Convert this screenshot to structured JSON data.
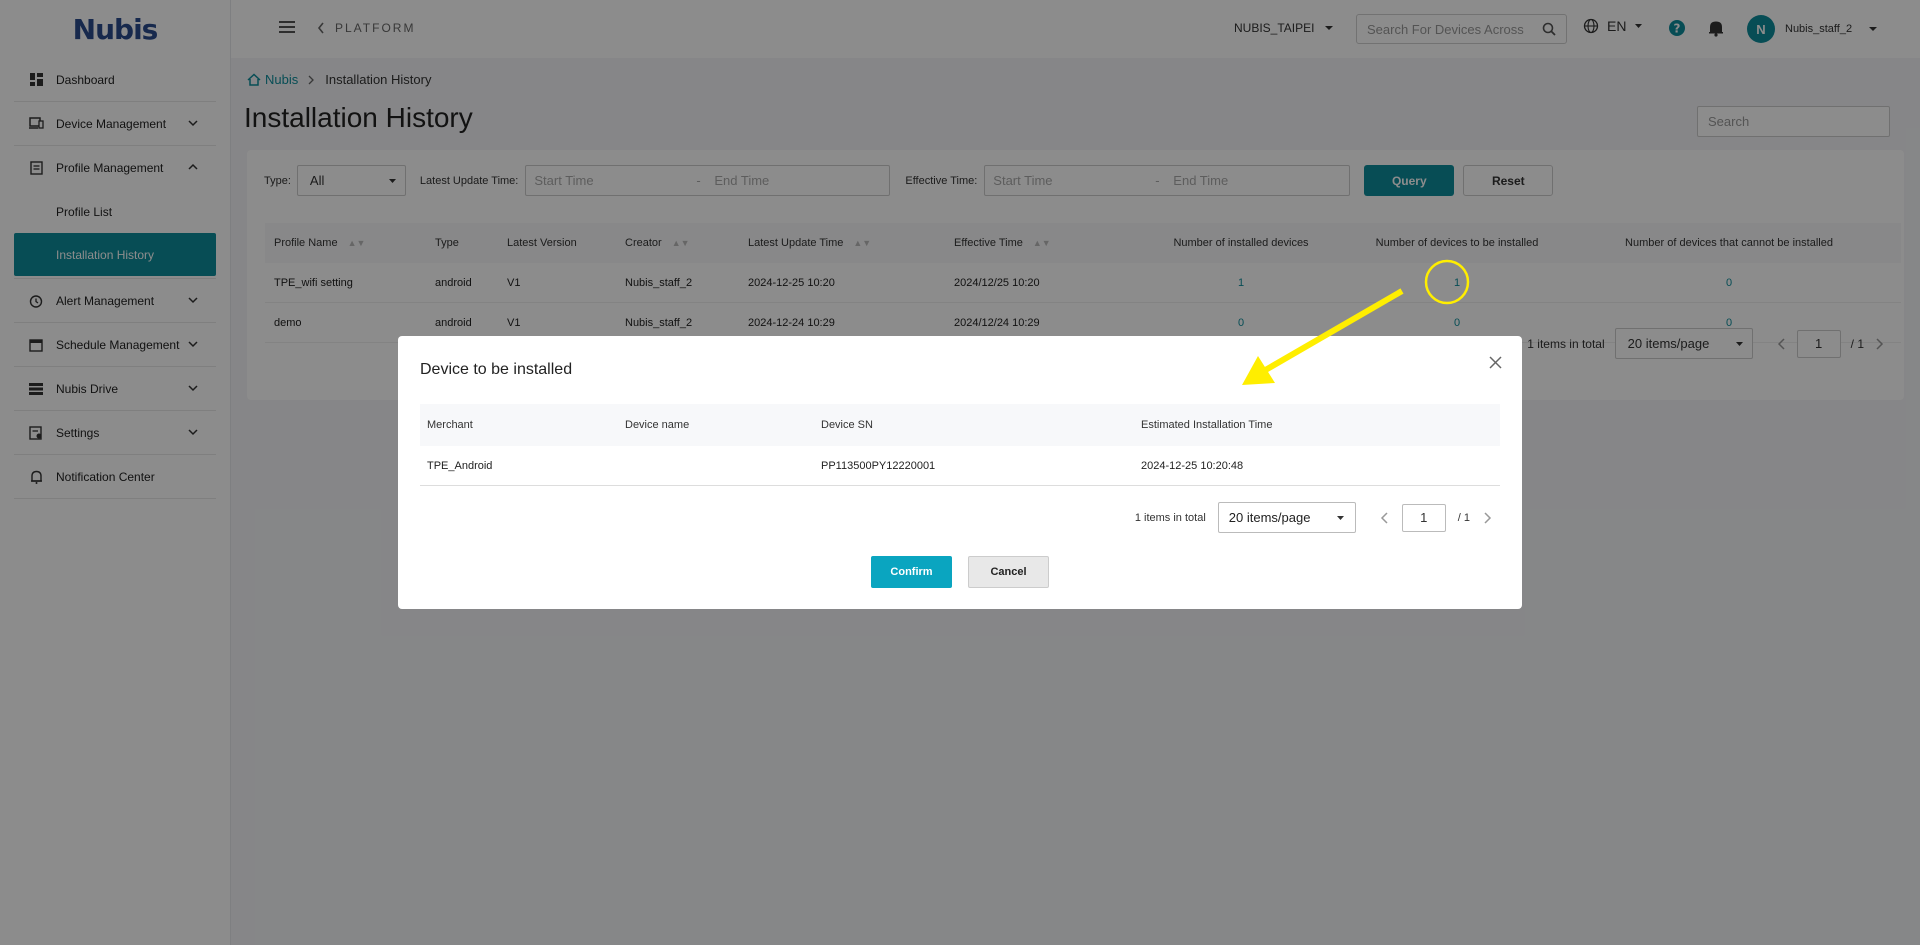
{
  "header": {
    "platform_label": "PLATFORM",
    "tenant": "NUBIS_TAIPEI",
    "search_placeholder": "Search For Devices Across",
    "language": "EN",
    "user_initial": "N",
    "user_name": "Nubis_staff_2"
  },
  "logo": {
    "text": "Nubis"
  },
  "sidebar": {
    "dashboard": "Dashboard",
    "device_management": "Device Management",
    "profile_management": "Profile Management",
    "profile_list": "Profile List",
    "installation_history": "Installation History",
    "alert_management": "Alert Management",
    "schedule_management": "Schedule Management",
    "nubis_drive": "Nubis Drive",
    "settings": "Settings",
    "notification_center": "Notification Center"
  },
  "breadcrumb": {
    "home": "Nubis",
    "current": "Installation History"
  },
  "page": {
    "title": "Installation History",
    "search_placeholder": "Search"
  },
  "filters": {
    "type_label": "Type:",
    "type_value": "All",
    "latest_update_label": "Latest Update Time:",
    "start_placeholder": "Start Time",
    "separator": "-",
    "end_placeholder": "End Time",
    "effective_label": "Effective Time:",
    "query": "Query",
    "reset": "Reset"
  },
  "table": {
    "headers": [
      "Profile Name",
      "Type",
      "Latest Version",
      "Creator",
      "Latest Update Time",
      "Effective Time",
      "Number of installed devices",
      "Number of devices to be installed",
      "Number of devices that cannot be installed"
    ],
    "rows": [
      [
        "TPE_wifi setting",
        "android",
        "V1",
        "Nubis_staff_2",
        "2024-12-25 10:20",
        "2024/12/25 10:20",
        "1",
        "1",
        "0"
      ],
      [
        "demo",
        "android",
        "V1",
        "Nubis_staff_2",
        "2024-12-24 10:29",
        "2024/12/24 10:29",
        "0",
        "0",
        "0"
      ]
    ]
  },
  "pager": {
    "total": "1 items in total",
    "per_page": "20 items/page",
    "page": "1",
    "of": "/ 1"
  },
  "modal": {
    "title": "Device to be installed",
    "headers": [
      "Merchant",
      "Device name",
      "Device SN",
      "Estimated Installation Time"
    ],
    "rows": [
      [
        "TPE_Android",
        "",
        "PP113500PY12220001",
        "2024-12-25 10:20:48"
      ]
    ],
    "total": "1 items in total",
    "per_page": "20 items/page",
    "page": "1",
    "of": "/ 1",
    "confirm": "Confirm",
    "cancel": "Cancel"
  },
  "colors": {
    "accent": "#0d8d9c",
    "confirm": "#0aa5c0",
    "annotation": "#ffee00"
  }
}
